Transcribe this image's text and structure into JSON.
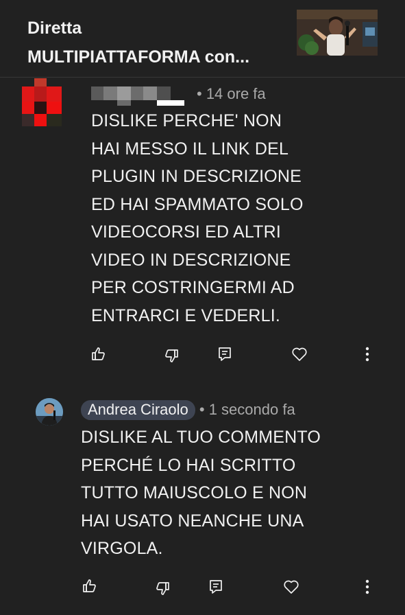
{
  "header": {
    "title_lines": [
      "Diretta",
      "MULTIPIATTAFORMA con..."
    ],
    "thumbnail_icon": "video-thumbnail"
  },
  "comments": [
    {
      "author": "",
      "time": "• 14 ore fa",
      "text_lines": [
        "DISLIKE PERCHE' NON",
        "HAI MESSO IL LINK DEL",
        "PLUGIN IN DESCRIZIONE",
        "ED HAI SPAMMATO SOLO",
        "VIDEOCORSI ED ALTRI",
        "VIDEO IN DESCRIZIONE",
        "PER COSTRINGERMI AD",
        "ENTRARCI E VEDERLI."
      ]
    },
    {
      "author": "Andrea Ciraolo",
      "time": "• 1 secondo fa",
      "text_lines": [
        "DISLIKE AL TUO COMMENTO",
        "PERCHÉ LO HAI SCRITTO",
        "TUTTO MAIUSCOLO E NON",
        "HAI USATO NEANCHE UNA",
        "VIRGOLA."
      ]
    }
  ],
  "colors": {
    "background": "#212121",
    "text": "#f1f1f1",
    "meta": "#aaaaaa",
    "author_chip": "#3e4452"
  }
}
